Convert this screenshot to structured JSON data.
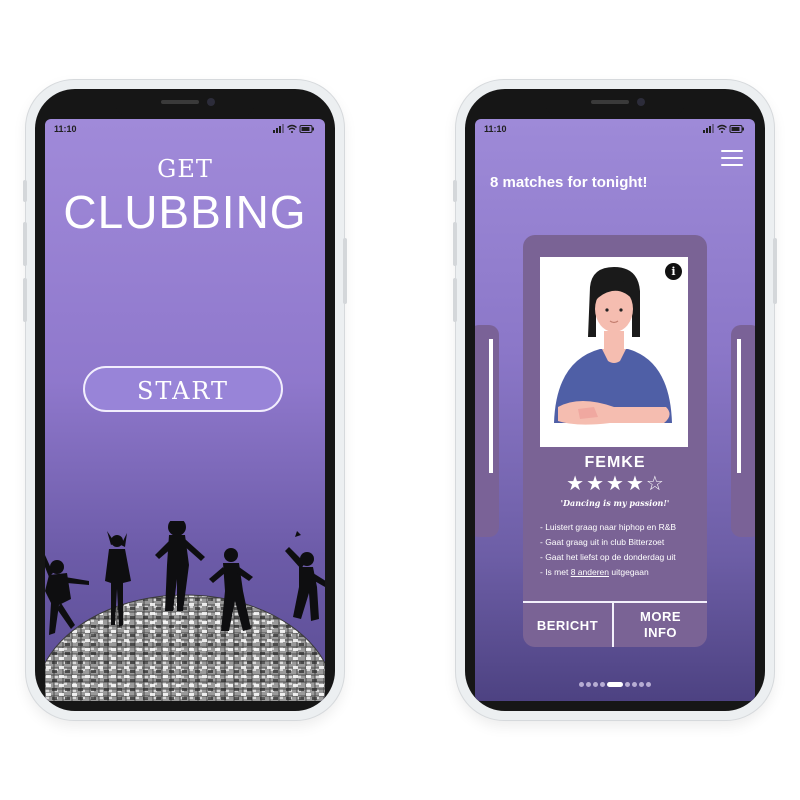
{
  "left_phone": {
    "status_time": "11:10",
    "title_small": "GET",
    "title_large": "CLUBBING",
    "start_label": "START"
  },
  "right_phone": {
    "status_time": "11:10",
    "matches_title": "8 matches for tonight!",
    "profile": {
      "name": "FEMKE",
      "rating": 4,
      "max_rating": 5,
      "quote": "'Dancing is my passion!'",
      "bullets": [
        "- Luistert graag naar hiphop en R&B",
        "- Gaat graag uit in club Bitterzoet",
        "- Gaat het liefst op de donderdag uit"
      ],
      "last_bullet_prefix": "- Is met",
      "last_bullet_link": "8 anderen",
      "last_bullet_suffix": "uitgegaan"
    },
    "actions": {
      "message": "BERICHT",
      "more_line1": "MORE",
      "more_line2": "INFO"
    },
    "pagination": {
      "count": 9,
      "active_index": 4
    }
  },
  "colors": {
    "gradient_top": "#a08ad9",
    "gradient_bottom": "#5b4d94",
    "card": "#7a6395",
    "start_button": "#9884d8",
    "shirt": "#4f5fa6",
    "hair": "#1a1a1a",
    "skin": "#f5bdb0"
  },
  "icons": [
    "signal-icon",
    "wifi-icon",
    "battery-icon",
    "menu-icon",
    "info-icon",
    "star-icon",
    "star-outline-icon"
  ]
}
